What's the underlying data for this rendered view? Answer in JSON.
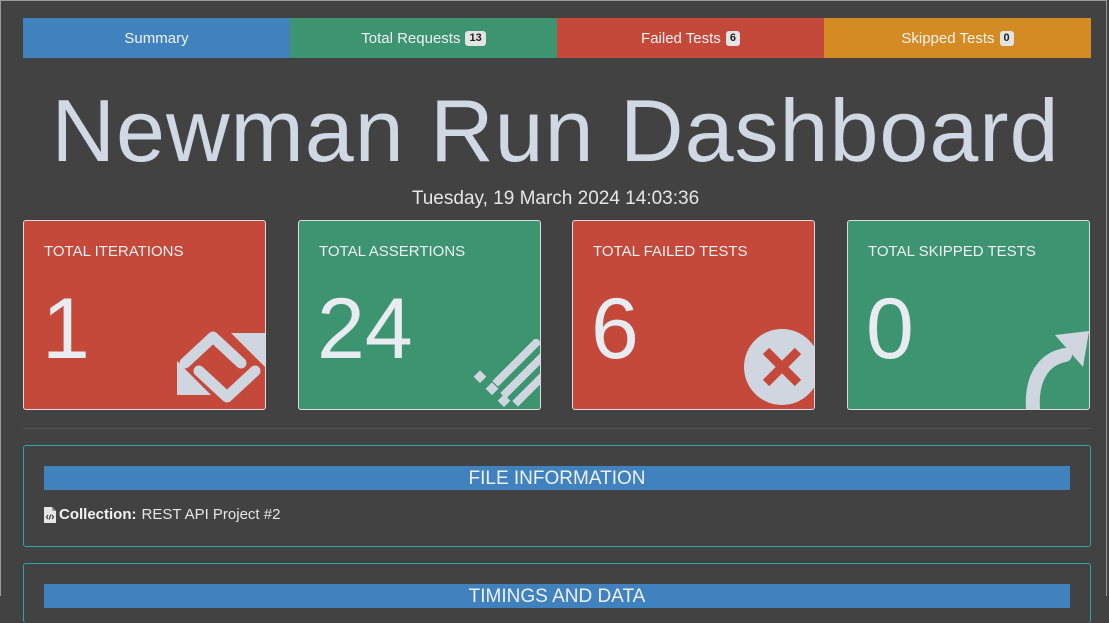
{
  "tabs": [
    {
      "label": "Summary",
      "badge": null,
      "color": "#3f82bd"
    },
    {
      "label": "Total Requests",
      "badge": "13",
      "color": "#3d9470"
    },
    {
      "label": "Failed Tests",
      "badge": "6",
      "color": "#c4493b"
    },
    {
      "label": "Skipped Tests",
      "badge": "0",
      "color": "#d48b23"
    }
  ],
  "page": {
    "title": "Newman Run Dashboard",
    "timestamp": "Tuesday, 19 March 2024 14:03:36"
  },
  "cards": [
    {
      "label": "TOTAL ITERATIONS",
      "value": "1",
      "icon": "sync-icon",
      "color": "#c4493b"
    },
    {
      "label": "TOTAL ASSERTIONS",
      "value": "24",
      "icon": "list-check-icon",
      "color": "#3d9470"
    },
    {
      "label": "TOTAL FAILED TESTS",
      "value": "6",
      "icon": "times-circle-icon",
      "color": "#c4493b"
    },
    {
      "label": "TOTAL SKIPPED TESTS",
      "value": "0",
      "icon": "share-arrow-icon",
      "color": "#3d9470"
    }
  ],
  "file_info": {
    "header": "FILE INFORMATION",
    "collection_label": "Collection:",
    "collection_value": "REST API Project #2"
  },
  "timings": {
    "header": "TIMINGS AND DATA"
  }
}
